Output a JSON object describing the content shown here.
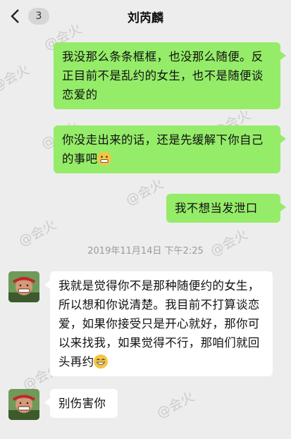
{
  "header": {
    "back_icon": "chevron-left-icon",
    "unread_count": "3",
    "title": "刘芮麟"
  },
  "messages": [
    {
      "side": "right",
      "text": "我没那么条条框框，也没那么随便。反正目前不是乱约的女生，也不是随便谈恋爱的"
    },
    {
      "side": "right",
      "text": "你没走出来的话，还是先缓解下你自己的事吧",
      "emoji": "grimace-emoji"
    },
    {
      "side": "right",
      "text": "我不想当发泄口"
    },
    {
      "side": "left",
      "text": "我就是觉得你不是那种随便约的女生，所以想和你说清楚。我目前不打算谈恋爱，如果你接受只是开心就好，那你可以来找我，如果觉得不行，那咱们就回头再约",
      "emoji": "grin-emoji"
    },
    {
      "side": "left",
      "text": "别伤害你"
    }
  ],
  "timestamp": "2019年11月14日 下午2:25",
  "watermark": "@会火",
  "colors": {
    "sent_bubble": "#95ec69",
    "received_bubble": "#ffffff",
    "background": "#ededed"
  }
}
